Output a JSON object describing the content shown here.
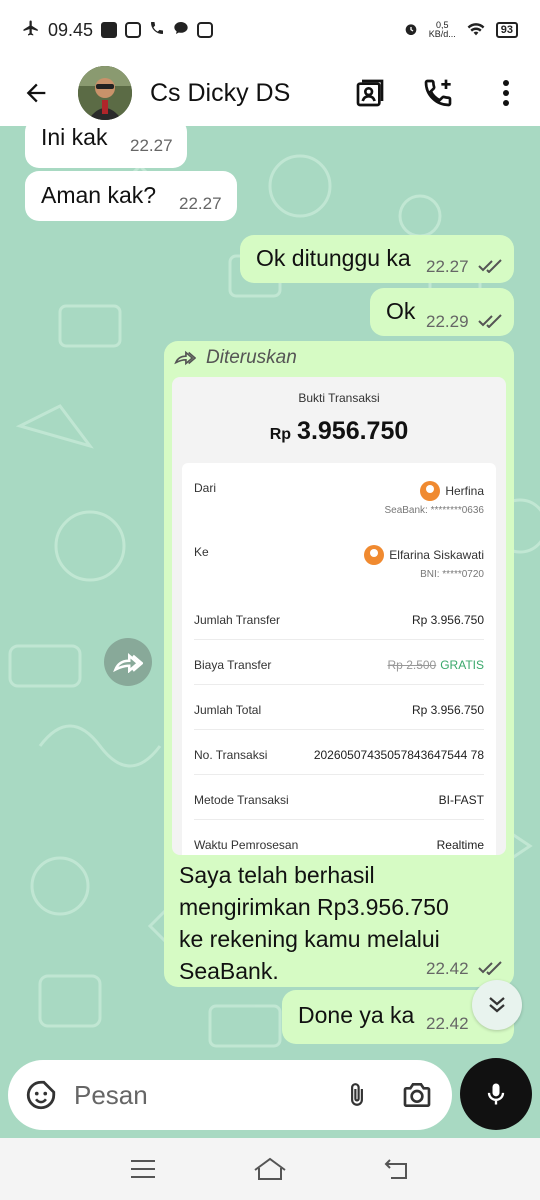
{
  "status_bar": {
    "time": "09.45",
    "net_speed_top": "0,5",
    "net_speed_unit": "KB/d...",
    "battery": "93"
  },
  "header": {
    "contact_name": "Cs Dicky DS"
  },
  "messages": [
    {
      "text": "Ini kak",
      "time": "22.27"
    },
    {
      "text": "Aman kak?",
      "time": "22.27"
    },
    {
      "text": "Ok ditunggu ka",
      "time": "22.27"
    },
    {
      "text": "Ok",
      "time": "22.29"
    },
    {
      "caption_line1": "Saya telah berhasil",
      "caption_line2": "mengirimkan Rp3.956.750",
      "caption_line3": "ke rekening kamu melalui",
      "caption_line4": "SeaBank.",
      "time": "22.42"
    },
    {
      "text": "Done ya ka",
      "time": "22.42"
    }
  ],
  "forwarded": {
    "label": "Diteruskan"
  },
  "receipt": {
    "title": "Bukti Transaksi",
    "currency": "Rp",
    "amount": "3.956.750",
    "from_label": "Dari",
    "from_name": "Herfina",
    "from_account": "SeaBank: ********0636",
    "to_label": "Ke",
    "to_name": "Elfarina Siskawati",
    "to_account": "BNI: *****0720",
    "rows": [
      {
        "label": "Jumlah Transfer",
        "value": "Rp 3.956.750"
      },
      {
        "label": "Biaya Transfer",
        "value": "Rp 2.500",
        "extra": "GRATIS"
      },
      {
        "label": "Jumlah Total",
        "value": "Rp 3.956.750"
      },
      {
        "label": "No. Transaksi",
        "value": "20260507435057843647544 78"
      },
      {
        "label": "Metode Transaksi",
        "value": "BI-FAST"
      },
      {
        "label": "Waktu Pemrosesan",
        "value": "Realtime"
      }
    ]
  },
  "input": {
    "placeholder": "Pesan"
  },
  "colors": {
    "chat_bg": "#a8d9c2",
    "outgoing": "#d6fbc4",
    "incoming": "#ffffff",
    "gratis": "#3aa86b",
    "sender_pic": "#f08a30"
  }
}
